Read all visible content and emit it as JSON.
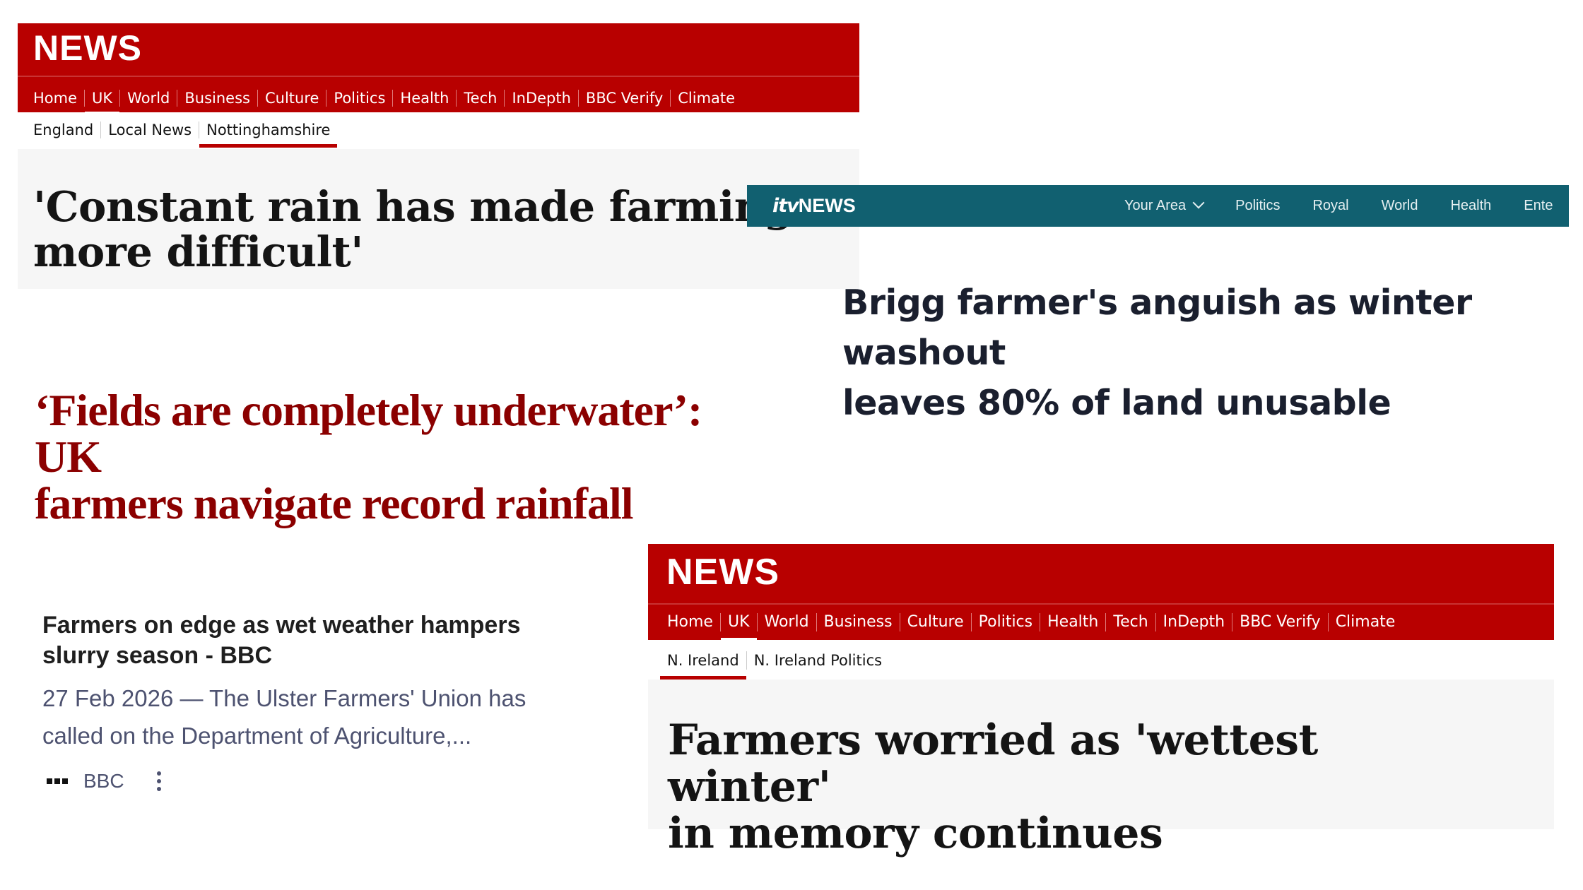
{
  "bbc_clip_1": {
    "logo": "NEWS",
    "nav": [
      "Home",
      "UK",
      "World",
      "Business",
      "Culture",
      "Politics",
      "Health",
      "Tech",
      "InDepth",
      "BBC Verify",
      "Climate"
    ],
    "nav_active": "UK",
    "subnav": [
      "England",
      "Local News",
      "Nottinghamshire"
    ],
    "subnav_active": "Nottinghamshire",
    "headline_line1": "'Constant rain has made farming",
    "headline_line2": "more difficult'"
  },
  "itv_clip": {
    "logo_mark": "itv",
    "logo_text": "NEWS",
    "nav": [
      "Your Area",
      "Politics",
      "Royal",
      "World",
      "Health",
      "Ente"
    ],
    "headline_line1": "Brigg farmer's anguish as winter washout",
    "headline_line2": "leaves 80% of land unusable"
  },
  "guardian_clip": {
    "headline_line1": "‘Fields are completely underwater’: UK",
    "headline_line2": "farmers navigate record rainfall"
  },
  "search_result": {
    "title_line1": "Farmers on edge as wet weather hampers",
    "title_line2": "slurry season - BBC",
    "snippet_line1": "27 Feb 2026 — The Ulster Farmers' Union has",
    "snippet_line2": "called on the Department of Agriculture,...",
    "source": "BBC",
    "favicon_icon": "bbc-blocks-icon",
    "menu_icon": "more-vert-icon"
  },
  "bbc_clip_2": {
    "logo": "NEWS",
    "nav": [
      "Home",
      "UK",
      "World",
      "Business",
      "Culture",
      "Politics",
      "Health",
      "Tech",
      "InDepth",
      "BBC Verify",
      "Climate"
    ],
    "nav_active": "UK",
    "subnav": [
      "N. Ireland",
      "N. Ireland Politics"
    ],
    "subnav_active": "N. Ireland",
    "headline_line1": "Farmers worried as 'wettest winter'",
    "headline_line2": "in memory continues"
  },
  "colors": {
    "bbc_red": "#b80000",
    "itv_teal": "#116070",
    "guardian_red": "#8b0000"
  }
}
